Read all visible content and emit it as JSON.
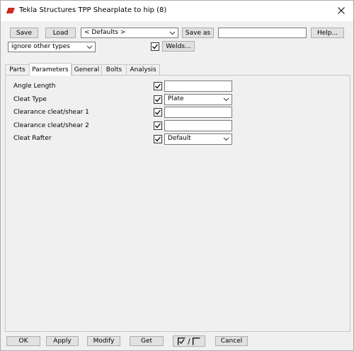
{
  "window": {
    "title": "Tekla Structures  TPP Shearplate to hip (8)"
  },
  "toolbar": {
    "save_label": "Save",
    "load_label": "Load",
    "preset_value": "< Defaults >",
    "save_as_label": "Save as",
    "save_as_value": "",
    "help_label": "Help...",
    "filter_value": "ignore other types",
    "welds_label": "Welds..."
  },
  "tabs": [
    {
      "label": "Parts"
    },
    {
      "label": "Parameters"
    },
    {
      "label": "General"
    },
    {
      "label": "Bolts"
    },
    {
      "label": "Analysis"
    }
  ],
  "active_tab": "Parameters",
  "parameters": [
    {
      "label": "Angle Length",
      "type": "text",
      "value": ""
    },
    {
      "label": "Cleat Type",
      "type": "select",
      "value": "Plate"
    },
    {
      "label": "Clearance cleat/shear 1",
      "type": "text",
      "value": ""
    },
    {
      "label": "Clearance cleat/shear 2",
      "type": "text",
      "value": ""
    },
    {
      "label": "Cleat  Rafter",
      "type": "select",
      "value": "Default"
    }
  ],
  "footer": {
    "ok_label": "OK",
    "apply_label": "Apply",
    "modify_label": "Modify",
    "get_label": "Get",
    "toggle_separator": "/",
    "cancel_label": "Cancel"
  },
  "colors": {
    "accent_icon": "#d42a1e",
    "button_bg": "#e1e1e1",
    "window_bg": "#f0f0f0"
  }
}
